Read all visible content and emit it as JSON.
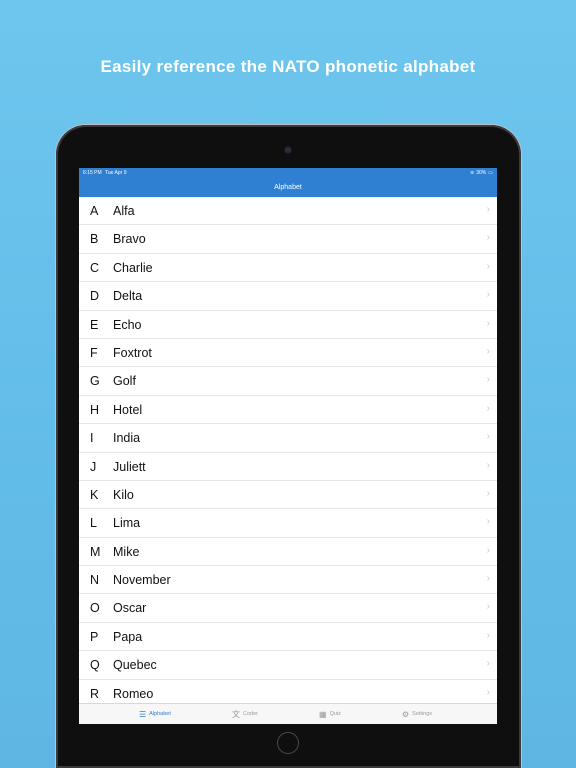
{
  "headline": "Easily reference the NATO phonetic alphabet",
  "status_bar": {
    "time": "6:15 PM",
    "date": "Tue Apr 9",
    "battery": "30%"
  },
  "nav": {
    "title": "Alphabet"
  },
  "rows": [
    {
      "letter": "A",
      "word": "Alfa"
    },
    {
      "letter": "B",
      "word": "Bravo"
    },
    {
      "letter": "C",
      "word": "Charlie"
    },
    {
      "letter": "D",
      "word": "Delta"
    },
    {
      "letter": "E",
      "word": "Echo"
    },
    {
      "letter": "F",
      "word": "Foxtrot"
    },
    {
      "letter": "G",
      "word": "Golf"
    },
    {
      "letter": "H",
      "word": "Hotel"
    },
    {
      "letter": "I",
      "word": "India"
    },
    {
      "letter": "J",
      "word": "Juliett"
    },
    {
      "letter": "K",
      "word": "Kilo"
    },
    {
      "letter": "L",
      "word": "Lima"
    },
    {
      "letter": "M",
      "word": "Mike"
    },
    {
      "letter": "N",
      "word": "November"
    },
    {
      "letter": "O",
      "word": "Oscar"
    },
    {
      "letter": "P",
      "word": "Papa"
    },
    {
      "letter": "Q",
      "word": "Quebec"
    },
    {
      "letter": "R",
      "word": "Romeo"
    }
  ],
  "tabs": [
    {
      "label": "Alphabet",
      "icon": "list-icon",
      "active": true
    },
    {
      "label": "Coder",
      "icon": "translate-icon",
      "active": false
    },
    {
      "label": "Quiz",
      "icon": "quiz-icon",
      "active": false
    },
    {
      "label": "Settings",
      "icon": "gear-icon",
      "active": false
    }
  ],
  "colors": {
    "accent": "#2f7fd2",
    "background": "#6ec6ee",
    "chevron": "#c7c7cc"
  }
}
